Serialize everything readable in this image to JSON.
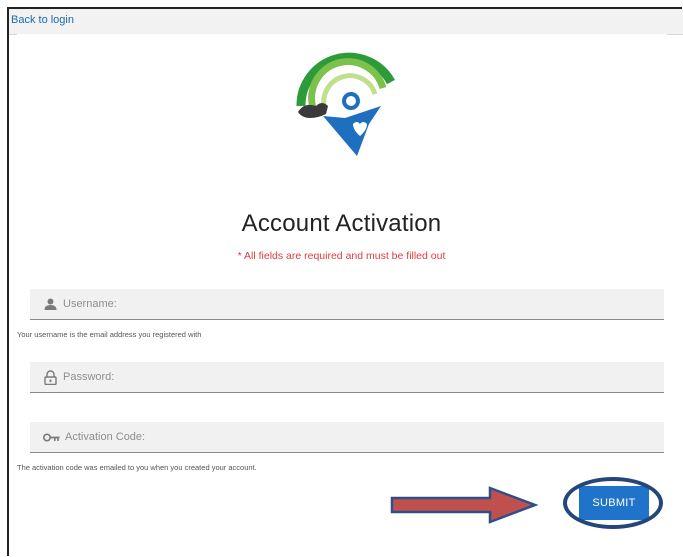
{
  "nav": {
    "back_label": "Back to login"
  },
  "form": {
    "title": "Account Activation",
    "required_note": "* All fields are required and must be filled out",
    "fields": [
      {
        "icon": "user-icon",
        "label": "Username:",
        "hint": "Your username is the email address you registered with"
      },
      {
        "icon": "lock-icon",
        "label": "Password:",
        "hint": ""
      },
      {
        "icon": "key-icon",
        "label": "Activation Code:",
        "hint": "The activation code was emailed to you when you created your account."
      }
    ],
    "submit_label": "SUBMIT"
  },
  "colors": {
    "accent": "#1f73c8",
    "required": "#e03c3c",
    "link": "#1a6aa8",
    "annotation_ring": "#25467a",
    "annotation_arrow": "#c0504d"
  }
}
